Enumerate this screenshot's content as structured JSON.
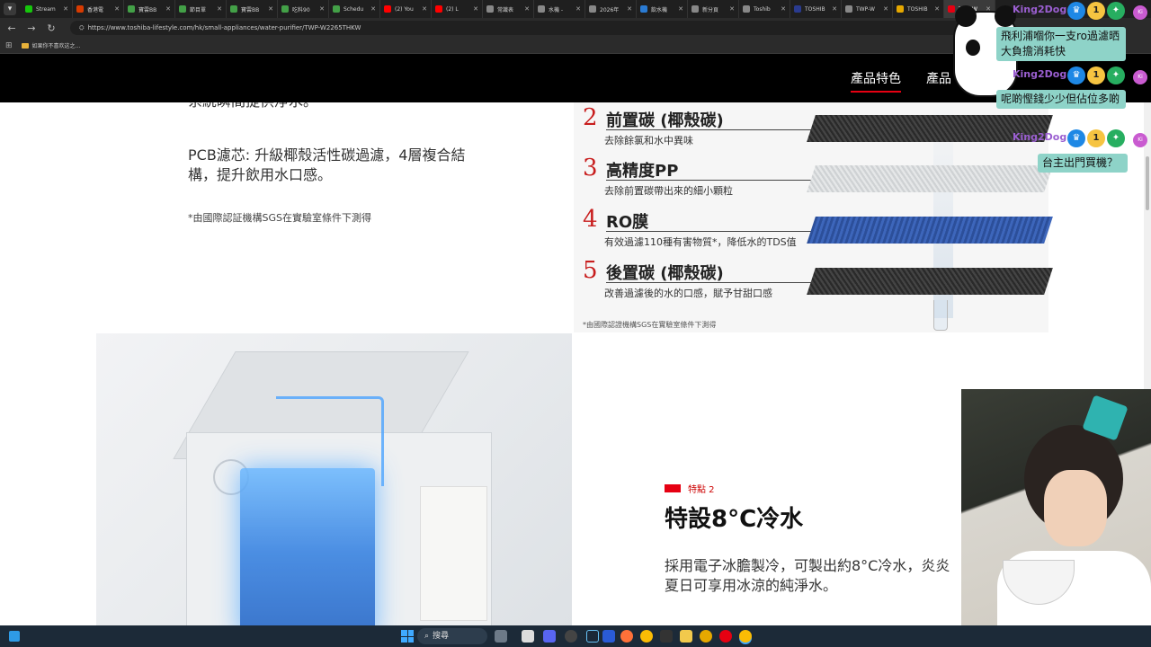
{
  "browser": {
    "tabs": [
      {
        "label": "Stream",
        "color": "#16c60c"
      },
      {
        "label": "香港電",
        "color": "#d83b01"
      },
      {
        "label": "寶雲BB",
        "color": "#43a047"
      },
      {
        "label": "節目單",
        "color": "#43a047"
      },
      {
        "label": "寶雲BB",
        "color": "#43a047"
      },
      {
        "label": "吃料90",
        "color": "#43a047"
      },
      {
        "label": "Schedu",
        "color": "#43a047"
      },
      {
        "label": "(2) You",
        "color": "#ff0000"
      },
      {
        "label": "(2) L",
        "color": "#ff0000"
      },
      {
        "label": "常識表",
        "color": "#888888"
      },
      {
        "label": "水機 -",
        "color": "#888888"
      },
      {
        "label": "2026年",
        "color": "#888888"
      },
      {
        "label": "飲水機",
        "color": "#2a7bd3"
      },
      {
        "label": "新分頁",
        "color": "#888888"
      },
      {
        "label": "Toshib",
        "color": "#888888"
      },
      {
        "label": "TOSHIB",
        "color": "#2a3b8f"
      },
      {
        "label": "TWP-W",
        "color": "#888888"
      },
      {
        "label": "TOSHIB",
        "color": "#e6a800"
      },
      {
        "label": "TWP-W",
        "color": "#e60012",
        "active": true
      }
    ],
    "url": "https://www.toshiba-lifestyle.com/hk/small-appliances/water-purifier/TWP-W2265THKW",
    "bookmark": "如果你不喜欢这之..."
  },
  "site": {
    "nav_active": "產品特色",
    "nav_next": "產品"
  },
  "content": {
    "para_cut": "系統瞬間提供淨水。",
    "para_pcb": "PCB濾芯: 升級椰殼活性碳過濾，4層複合結構，提升飲用水口感。",
    "note_sgs": "*由國際認証機構SGS在實驗室條件下測得",
    "filters": [
      {
        "num": "2",
        "name": "前置碳 (椰殼碳)",
        "desc": "去除餘氯和水中異味",
        "sheet": "dark"
      },
      {
        "num": "3",
        "name": "高精度PP",
        "desc": "去除前置碳帶出來的細小顆粒",
        "sheet": "light"
      },
      {
        "num": "4",
        "name": "RO膜",
        "desc": "有效過濾110種有害物質*，降低水的TDS值",
        "sheet": "blue"
      },
      {
        "num": "5",
        "name": "後置碳 (椰殼碳)",
        "desc": "改善過濾後的水的口感，賦予甘甜口感",
        "sheet": "dark"
      }
    ],
    "filter_note": "*由國際認證機構SGS在實驗室條件下測得",
    "feature_tag": "特點 2",
    "feature_title": "特設8°C冷水",
    "feature_desc": "採用電子冰膽製冷，可製出約8°C冷水，炎炎夏日可享用冰涼的純淨水。"
  },
  "chat": {
    "messages": [
      {
        "user": "King2Dog",
        "text": "飛利浦嗰你一支ro過濾晒 大負擔消耗快"
      },
      {
        "user": "King2Dog",
        "text": "呢啲慳錢少少但佔位多啲"
      },
      {
        "user": "King2Dog",
        "text": "台主出門買機？"
      }
    ],
    "badge_one": "1",
    "badge_ki": "Ki"
  },
  "taskbar": {
    "search_label": "搜尋"
  }
}
